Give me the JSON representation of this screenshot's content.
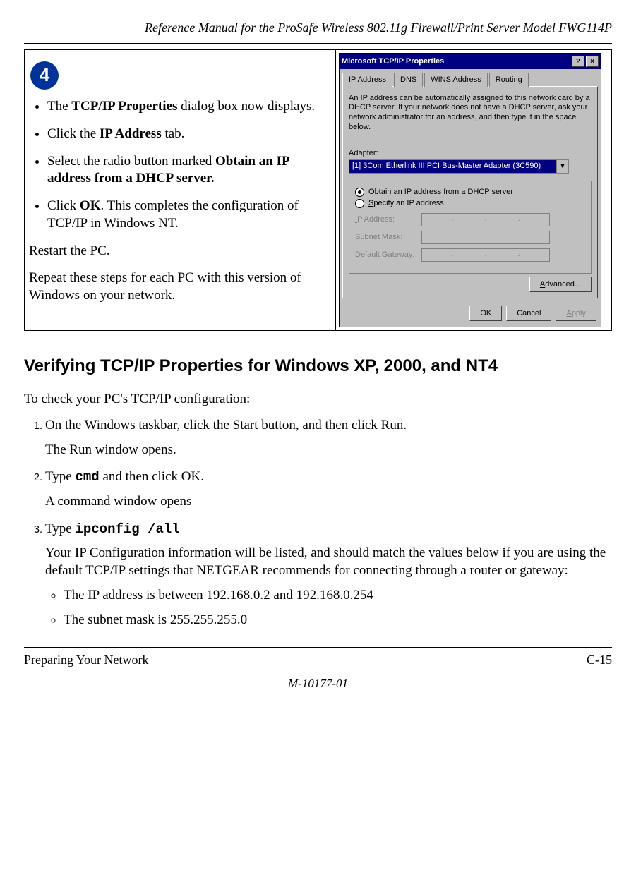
{
  "header": {
    "title": "Reference Manual for the ProSafe Wireless 802.11g  Firewall/Print Server Model FWG114P"
  },
  "step_badge": "4",
  "left_bullets": {
    "b1_pre": "The ",
    "b1_bold": "TCP/IP Properties",
    "b1_post": " dialog box now displays.",
    "b2_pre": "Click the ",
    "b2_bold": "IP Address",
    "b2_post": " tab.",
    "b3_pre": "Select the radio button marked ",
    "b3_bold": "Obtain an IP address from a DHCP server.",
    "b4_pre": "Click ",
    "b4_bold": "OK",
    "b4_post": ".  This completes the configuration of TCP/IP in Windows NT."
  },
  "paras": {
    "p1": "Restart the PC.",
    "p2": "Repeat these steps for each PC with this version of Windows on your network."
  },
  "dialog": {
    "title": "Microsoft TCP/IP Properties",
    "help": "?",
    "close": "×",
    "tabs": {
      "t1": "IP Address",
      "t2": "DNS",
      "t3": "WINS Address",
      "t4": "Routing"
    },
    "desc": "An IP address can be automatically assigned to this network card by a DHCP server. If your network does not have a DHCP server, ask your network administrator for an address, and then type it in the space below.",
    "adapter_label": "Adapter:",
    "adapter_value": "[1] 3Com Etherlink III PCI Bus-Master Adapter (3C590)",
    "radio1_u": "O",
    "radio1_rest": "btain an IP address from a DHCP server",
    "radio2_u": "S",
    "radio2_rest": "pecify an IP address",
    "fields": {
      "ip_u": "I",
      "ip": "P Address:",
      "sm_ux": "S",
      "sm": "ubnet Mask:",
      "gw": "Default Gateway:"
    },
    "dot": ".",
    "adv_u": "A",
    "adv": "dvanced...",
    "ok": "OK",
    "cancel": "Cancel",
    "apply_u": "A",
    "apply": "pply"
  },
  "section_heading": "Verifying TCP/IP Properties for Windows XP, 2000, and NT4",
  "intro": "To check your PC's TCP/IP configuration:",
  "steps": {
    "s1": "On the Windows taskbar, click the Start button, and then click Run.",
    "s1b": "The Run window opens.",
    "s2_pre": "Type ",
    "s2_cmd": "cmd",
    "s2_post": " and then click OK.",
    "s2b": "A command window opens",
    "s3_pre": "Type ",
    "s3_cmd": "ipconfig /all",
    "s3b": "Your IP Configuration information will be listed, and should match the values below if you are using the default TCP/IP settings that NETGEAR recommends for connecting through a router or gateway:",
    "s3_li1": "The IP address is between 192.168.0.2 and 192.168.0.254",
    "s3_li2": "The subnet mask is 255.255.255.0"
  },
  "footer": {
    "left": "Preparing Your Network",
    "right": "C-15",
    "center": "M-10177-01"
  }
}
